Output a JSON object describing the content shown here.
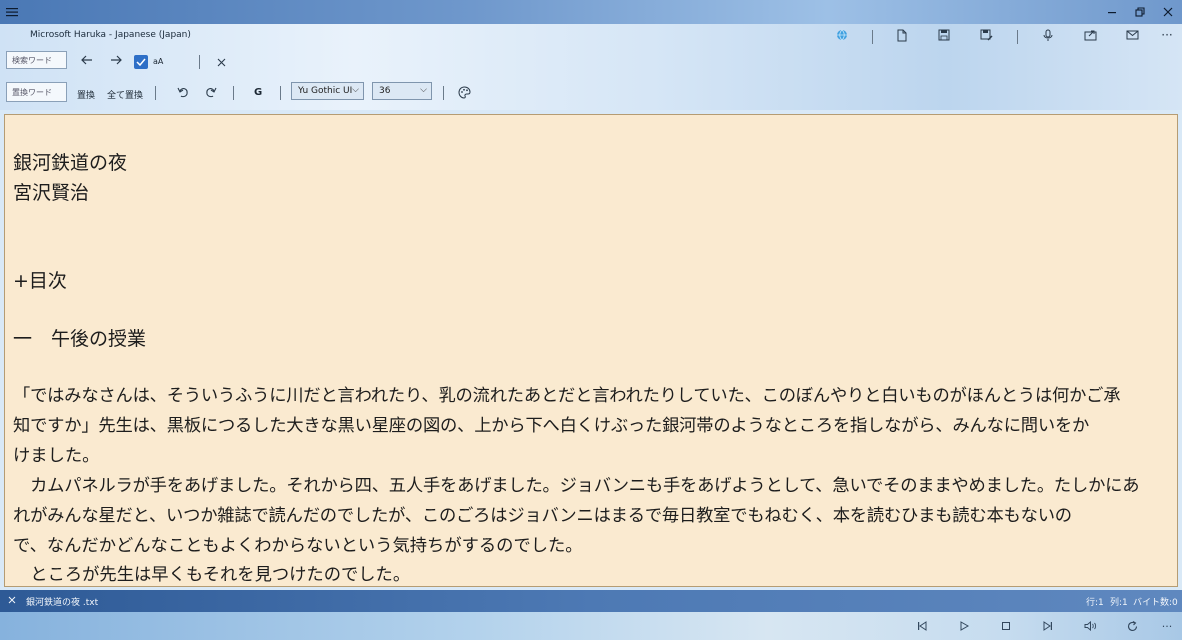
{
  "window": {
    "title": "Microsoft Haruka - Japanese (Japan)"
  },
  "toolbar": {
    "search_placeholder": "検索ワード",
    "replace_placeholder": "置換ワード",
    "case_label": "aA",
    "case_checked": true,
    "replace_label": "置換",
    "replace_all_label": "全て置換",
    "bold_label": "G",
    "font_family": "Yu Gothic UI",
    "font_size": "36"
  },
  "editor": {
    "lines": [
      "銀河鉄道の夜",
      "宮沢賢治",
      "+目次",
      "一　午後の授業",
      "「ではみなさんは、そういうふうに川だと言われたり、乳の流れたあとだと言われたりしていた、このぼんやりと白いものがほんとうは何かご承",
      "知ですか」先生は、黒板につるした大きな黒い星座の図の、上から下へ白くけぶった銀河帯のようなところを指しながら、みんなに問いをか",
      "けました。",
      "　カムパネルラが手をあげました。それから四、五人手をあげました。ジョバンニも手をあげようとして、急いでそのままやめました。たしかにあ",
      "れがみんな星だと、いつか雑誌で読んだのでしたが、このごろはジョバンニはまるで毎日教室でもねむく、本を読むひまも読む本もないの",
      "で、なんだかどんなこともよくわからないという気持ちがするのでした。",
      "　ところが先生は早くもそれを見つけたのでした。"
    ]
  },
  "status": {
    "filename": "銀河鉄道の夜 .txt",
    "row": "行:1",
    "col": "列:1",
    "bytes": "バイト数:0"
  },
  "icons": {
    "globe_color": "#3fa0e0"
  }
}
